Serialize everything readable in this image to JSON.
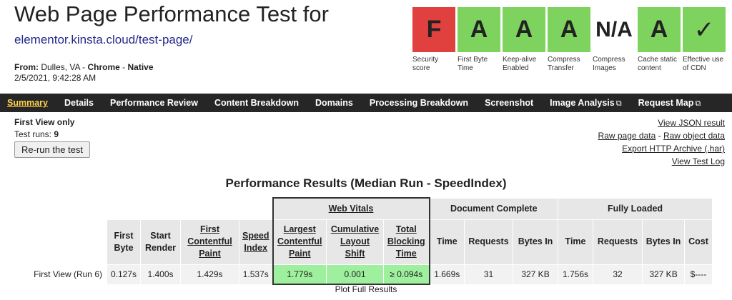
{
  "header": {
    "title": "Web Page Performance Test for",
    "url": "elementor.kinsta.cloud/test-page/",
    "from_label": "From:",
    "location": "Dulles, VA",
    "sep1": " - ",
    "browser": "Chrome",
    "sep2": " - ",
    "connection": "Native",
    "datetime": "2/5/2021, 9:42:28 AM"
  },
  "grades": [
    {
      "grade": "F",
      "label": "Security score",
      "color": "#e0413f"
    },
    {
      "grade": "A",
      "label": "First Byte Time",
      "color": "#7dd35e"
    },
    {
      "grade": "A",
      "label": "Keep-alive Enabled",
      "color": "#7dd35e"
    },
    {
      "grade": "A",
      "label": "Compress Transfer",
      "color": "#7dd35e"
    },
    {
      "grade": "N/A",
      "label": "Compress Images",
      "color": "#ffffff"
    },
    {
      "grade": "A",
      "label": "Cache static content",
      "color": "#7dd35e"
    },
    {
      "grade": "✓",
      "label": "Effective use of CDN",
      "color": "#7dd35e"
    }
  ],
  "nav": {
    "summary": "Summary",
    "details": "Details",
    "performance_review": "Performance Review",
    "content_breakdown": "Content Breakdown",
    "domains": "Domains",
    "processing_breakdown": "Processing Breakdown",
    "screenshot": "Screenshot",
    "image_analysis": "Image Analysis",
    "request_map": "Request Map"
  },
  "summary": {
    "first_view": "First View only",
    "test_runs_label": "Test runs: ",
    "test_runs": "9",
    "rerun": "Re-run the test"
  },
  "links": {
    "json": "View JSON result",
    "raw_page": "Raw page data",
    "dash": " - ",
    "raw_object": "Raw object data",
    "har": "Export HTTP Archive (.har)",
    "log": "View Test Log"
  },
  "results": {
    "title": "Performance Results (Median Run - SpeedIndex)",
    "groups": {
      "web_vitals": "Web Vitals",
      "document_complete": "Document Complete",
      "fully_loaded": "Fully Loaded"
    },
    "cols": {
      "first_byte": "First Byte",
      "start_render": "Start Render",
      "fcp": "First Contentful Paint",
      "speed_index": "Speed Index",
      "lcp": "Largest Contentful Paint",
      "cls": "Cumulative Layout Shift",
      "tbt": "Total Blocking Time",
      "dc_time": "Time",
      "dc_requests": "Requests",
      "dc_bytes": "Bytes In",
      "fl_time": "Time",
      "fl_requests": "Requests",
      "fl_bytes": "Bytes In",
      "cost": "Cost"
    },
    "row": {
      "label": "First View (",
      "run_link": "Run 6",
      "label_end": ")",
      "first_byte": "0.127s",
      "start_render": "1.400s",
      "fcp": "1.429s",
      "speed_index": "1.537s",
      "lcp": "1.779s",
      "cls": "0.001",
      "tbt": "≥ 0.094s",
      "dc_time": "1.669s",
      "dc_requests": "31",
      "dc_bytes": "327 KB",
      "fl_time": "1.756s",
      "fl_requests": "32",
      "fl_bytes": "327 KB",
      "cost": "$----"
    },
    "plot": "Plot Full Results"
  }
}
